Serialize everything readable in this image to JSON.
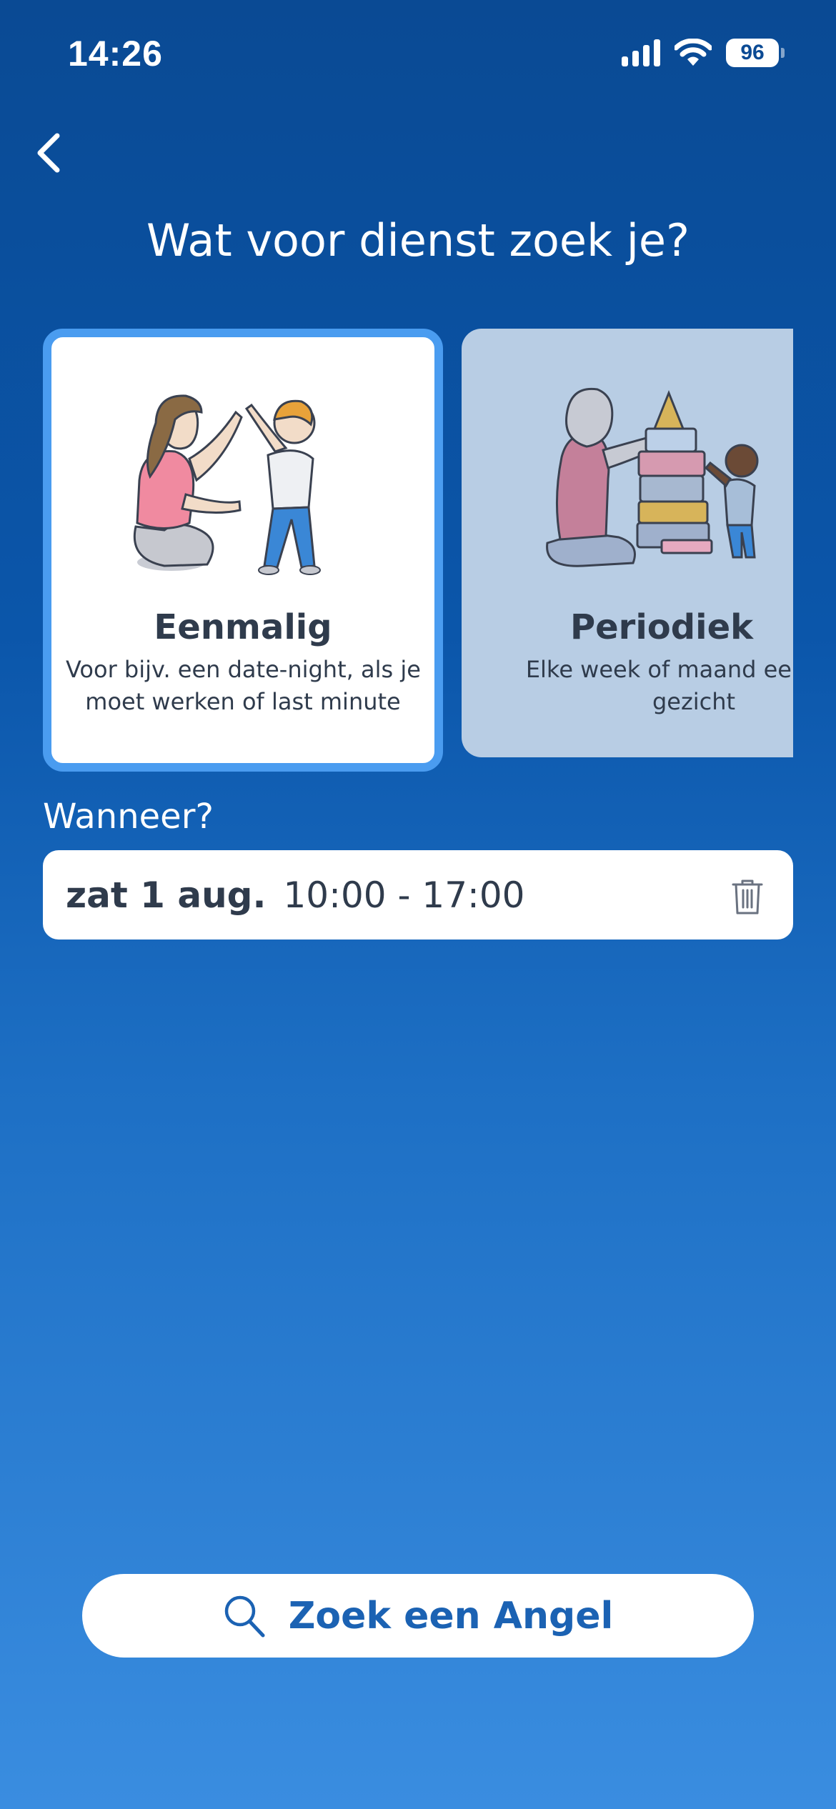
{
  "status_bar": {
    "time": "14:26",
    "battery": "96"
  },
  "header": {
    "title": "Wat voor dienst zoek je?"
  },
  "service_options": [
    {
      "title": "Eenmalig",
      "description_line1": "Voor bijv. een date-night, als je",
      "description_line2": "moet werken of last minute",
      "selected": true
    },
    {
      "title": "Periodiek",
      "description_line1": "Elke week of maand een vast",
      "description_line2": "gezicht",
      "selected": false
    }
  ],
  "when": {
    "label": "Wanneer?",
    "date": "zat 1 aug.",
    "time_range": "10:00 - 17:00"
  },
  "search_button": {
    "label": "Zoek een Angel"
  },
  "colors": {
    "accent": "#4a9cf0",
    "brand_text": "#1b62b3",
    "card_text": "#2f3b4c",
    "inactive_card": "#b8cde4"
  },
  "icons": [
    "back-chevron-icon",
    "signal-icon",
    "wifi-icon",
    "battery-icon",
    "trash-icon",
    "search-icon"
  ]
}
